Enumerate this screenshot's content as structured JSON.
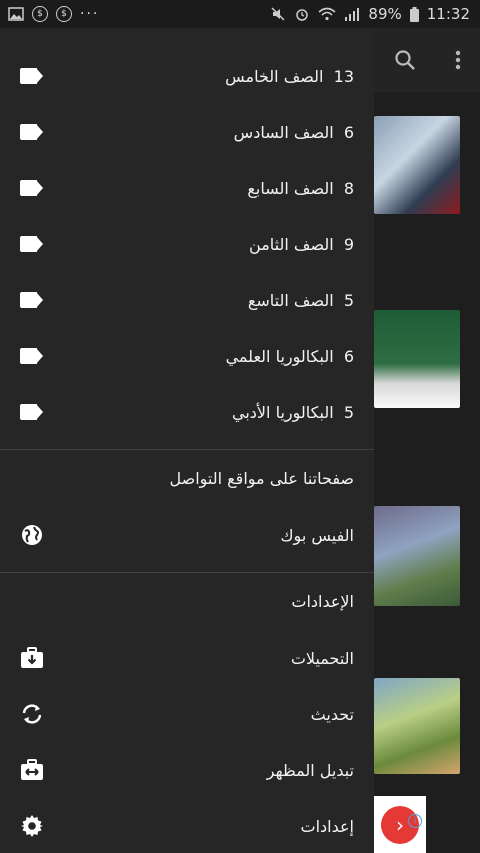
{
  "status_bar": {
    "dots": "···",
    "battery": "89%",
    "time": "11:32"
  },
  "background": {
    "card2_text": "",
    "ad_arrow": "›"
  },
  "drawer": {
    "grades": [
      {
        "count": "13",
        "label": "الصف الخامس"
      },
      {
        "count": "6",
        "label": "الصف السادس"
      },
      {
        "count": "8",
        "label": "الصف السابع"
      },
      {
        "count": "9",
        "label": "الصف الثامن"
      },
      {
        "count": "5",
        "label": "الصف التاسع"
      },
      {
        "count": "6",
        "label": "البكالوريا العلمي"
      },
      {
        "count": "5",
        "label": "البكالوريا الأدبي"
      }
    ],
    "social_title": "صفحاتنا على مواقع التواصل",
    "facebook_label": "الفيس بوك",
    "settings_title": "الإعدادات",
    "downloads_label": "التحميلات",
    "update_label": "تحديث",
    "theme_label": "تبديل المظهر",
    "preferences_label": "إعدادات"
  }
}
